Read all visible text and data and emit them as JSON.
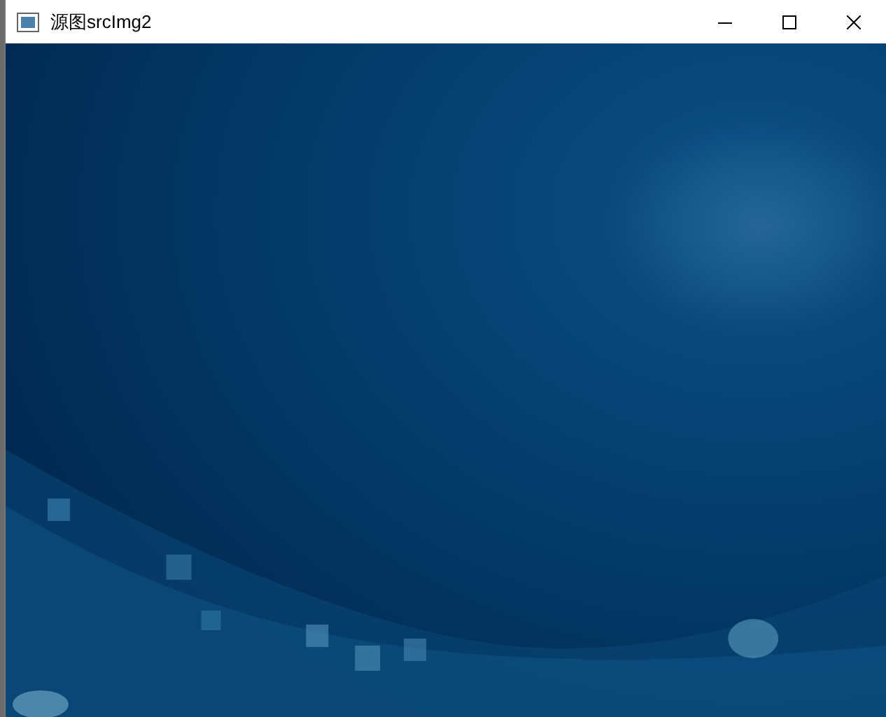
{
  "window": {
    "title": "源图srcImg2"
  }
}
